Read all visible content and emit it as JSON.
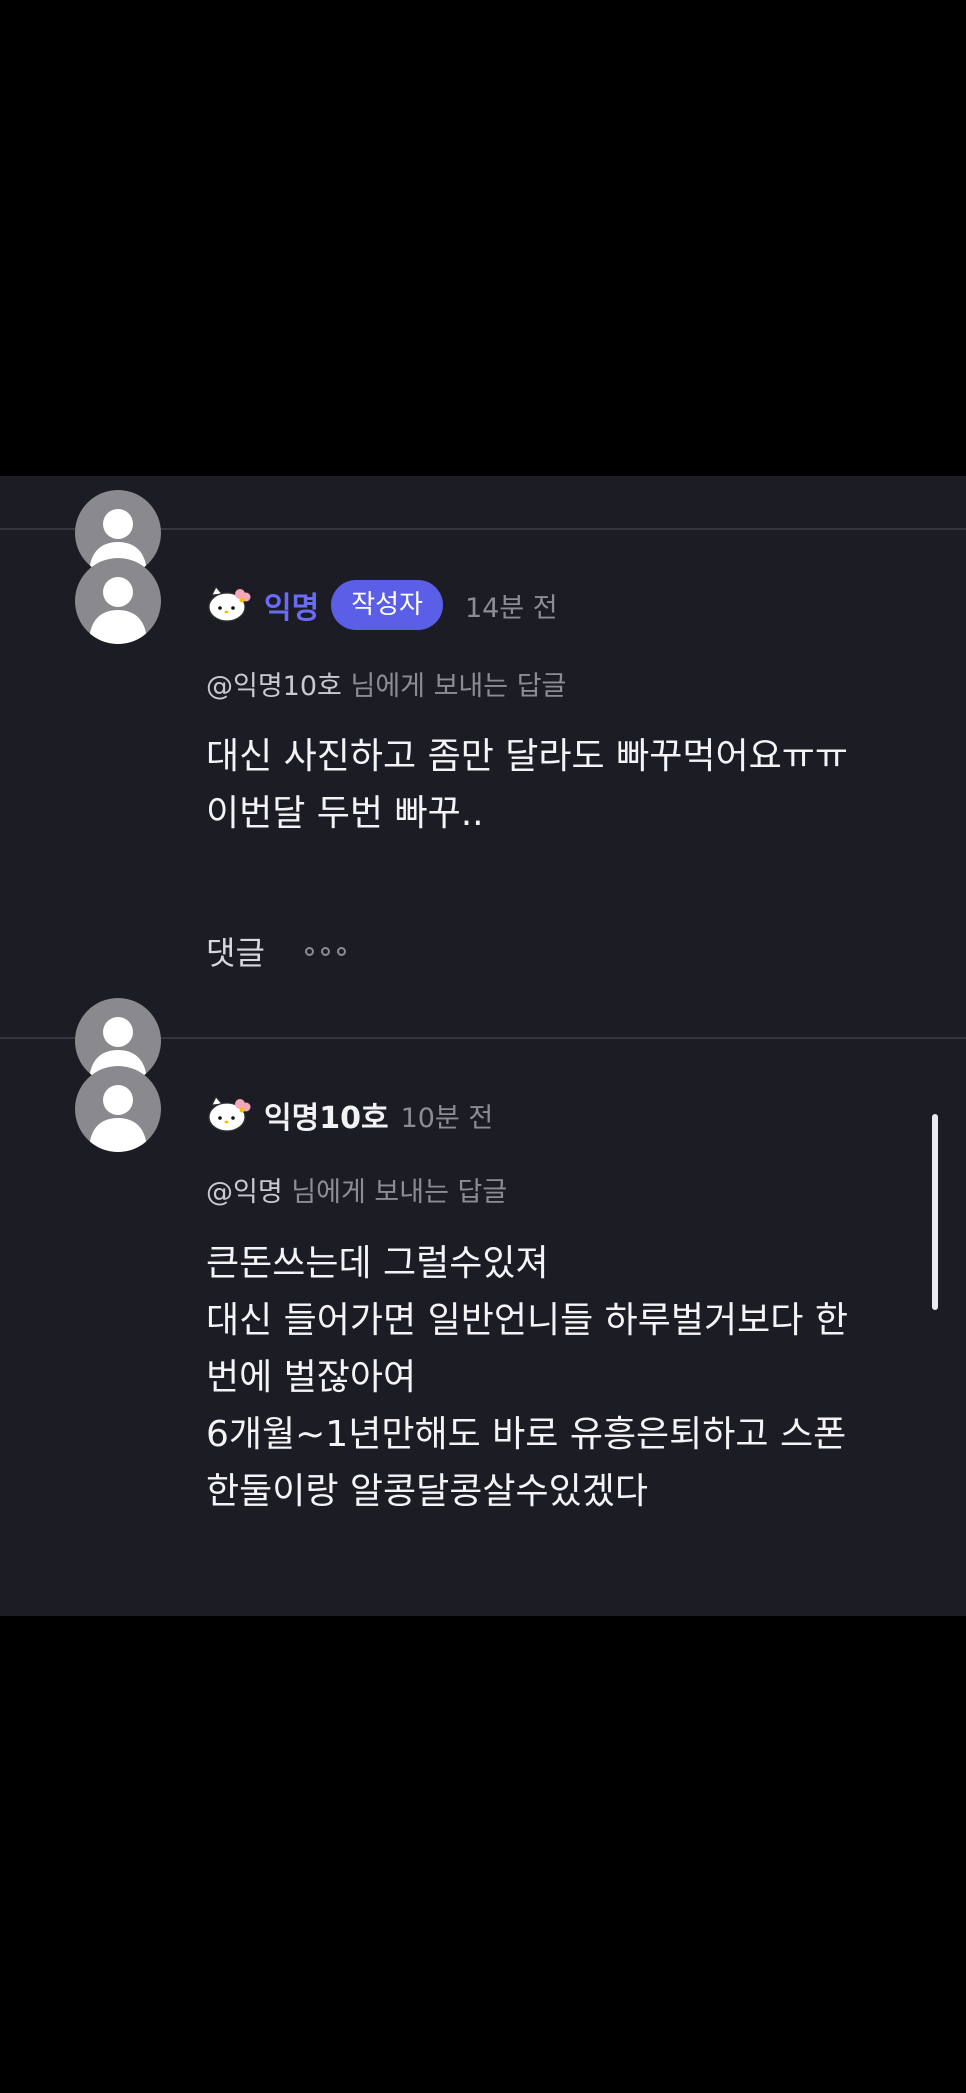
{
  "colors": {
    "page_background": "#000000",
    "panel_background": "#1c1d24",
    "author_op": "#6b6cf5",
    "badge_background": "#5b5ee6",
    "muted_text": "#8c8d94"
  },
  "comments": [
    {
      "icon": "hello-kitty-icon",
      "author": "익명",
      "badge": "작성자",
      "time": "14분 전",
      "reply_to_name": "@익명10호",
      "reply_to_suffix": "님에게 보내는 답글",
      "lines": [
        "대신 사진하고 좀만 달라도 빠꾸먹어요ㅠㅠ",
        "이번달 두번 빠꾸.."
      ],
      "reply_label": "댓글"
    },
    {
      "icon": "hello-kitty-icon",
      "author": "익명10호",
      "time": "10분 전",
      "reply_to_name": "@익명",
      "reply_to_suffix": "님에게 보내는 답글",
      "lines": [
        "큰돈쓰는데 그럴수있져",
        "대신 들어가면 일반언니들 하루벌거보다 한",
        "번에 벌잖아여",
        "6개월~1년만해도 바로 유흥은퇴하고 스폰",
        "한둘이랑 알콩달콩살수있겠다"
      ]
    }
  ]
}
